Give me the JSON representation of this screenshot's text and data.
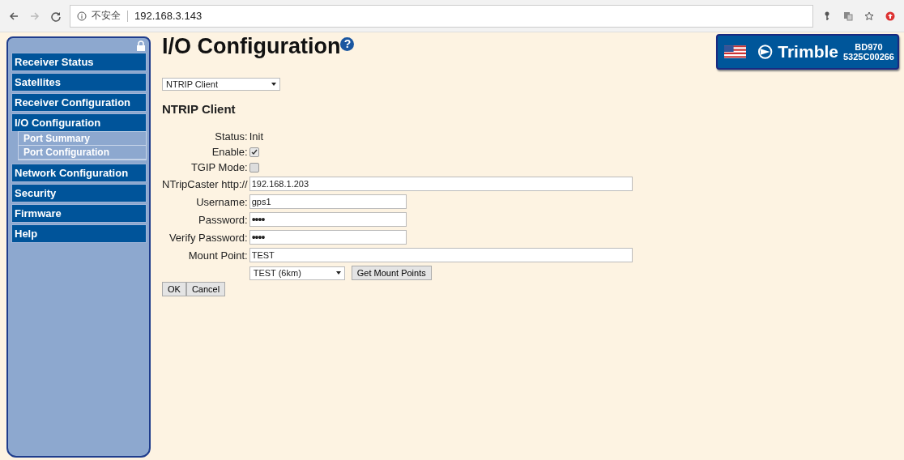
{
  "browser": {
    "security": "不安全",
    "url": "192.168.3.143"
  },
  "sidebar": {
    "items": [
      {
        "label": "Receiver Status"
      },
      {
        "label": "Satellites"
      },
      {
        "label": "Receiver Configuration"
      },
      {
        "label": "I/O Configuration",
        "children": [
          {
            "label": "Port Summary"
          },
          {
            "label": "Port Configuration"
          }
        ]
      },
      {
        "label": "Network Configuration"
      },
      {
        "label": "Security"
      },
      {
        "label": "Firmware"
      },
      {
        "label": "Help"
      }
    ]
  },
  "page": {
    "title": "I/O Configuration",
    "help_icon": "?"
  },
  "badge": {
    "brand": "Trimble",
    "model": "BD970",
    "serial": "5325C00266"
  },
  "port_select": {
    "value": "NTRIP Client"
  },
  "section_title": "NTRIP Client",
  "form": [
    {
      "kind": "status",
      "label": "Status:",
      "value": "Init"
    },
    {
      "kind": "checkbox",
      "label": "Enable:",
      "checked": true
    },
    {
      "kind": "checkbox",
      "label": "TGIP Mode:",
      "checked": false
    },
    {
      "kind": "wide",
      "label": "NTripCaster http://",
      "value": "192.168.1.203"
    },
    {
      "kind": "text",
      "label": "Username:",
      "value": "gps1"
    },
    {
      "kind": "password",
      "label": "Password:",
      "value": "••••"
    },
    {
      "kind": "password",
      "label": "Verify Password:",
      "value": "••••"
    },
    {
      "kind": "wide",
      "label": "Mount Point:",
      "value": "TEST"
    },
    {
      "kind": "mount",
      "select": "TEST (6km)",
      "button": "Get Mount Points"
    }
  ],
  "buttons": [
    "OK",
    "Cancel"
  ]
}
